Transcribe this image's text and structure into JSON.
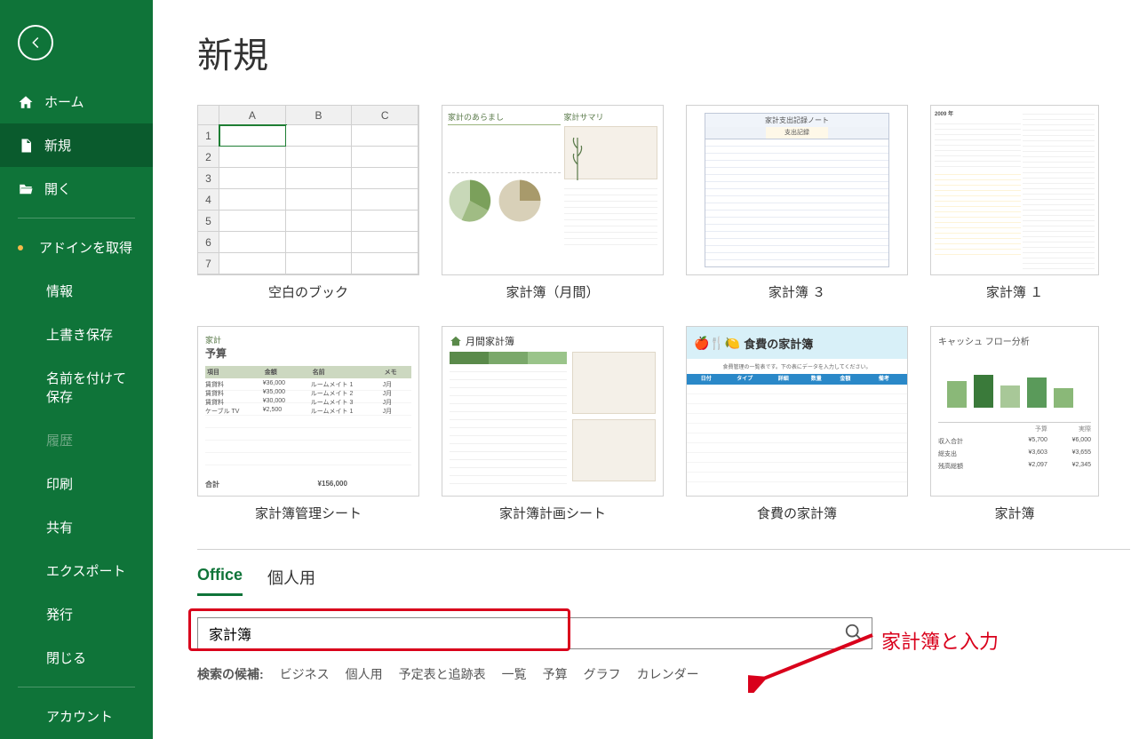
{
  "sidebar": {
    "home": "ホーム",
    "new": "新規",
    "open": "開く",
    "get_addins": "アドインを取得",
    "info": "情報",
    "save": "上書き保存",
    "save_as": "名前を付けて保存",
    "history": "履歴",
    "print": "印刷",
    "share": "共有",
    "export": "エクスポート",
    "publish": "発行",
    "close": "閉じる",
    "account": "アカウント"
  },
  "page_title": "新規",
  "templates_row1": [
    {
      "label": "空白のブック"
    },
    {
      "label": "家計簿（月間）"
    },
    {
      "label": "家計簿 ３"
    },
    {
      "label": "家計簿 １"
    }
  ],
  "templates_row2": [
    {
      "label": "家計簿管理シート"
    },
    {
      "label": "家計簿計画シート"
    },
    {
      "label": "食費の家計簿"
    },
    {
      "label": "家計簿"
    }
  ],
  "tabs": {
    "office": "Office",
    "personal": "個人用"
  },
  "search": {
    "value": "家計簿"
  },
  "annotation_text": "家計簿と入力",
  "suggested": {
    "label": "検索の候補:",
    "items": [
      "ビジネス",
      "個人用",
      "予定表と追跡表",
      "一覧",
      "予算",
      "グラフ",
      "カレンダー"
    ]
  },
  "thumb": {
    "blank_cols": [
      "A",
      "B",
      "C"
    ],
    "blank_rows": [
      "1",
      "2",
      "3",
      "4",
      "5",
      "6",
      "7"
    ],
    "t2_left_title": "家計のあらまし",
    "t2_right_title": "家計サマリ",
    "t3_title": "家計支出記録ノート",
    "t4_year": "2009 年",
    "t5_title": "予算",
    "t5_total": "¥156,000",
    "t6_title": "月間家計簿",
    "t7_title": "食費の家計簿",
    "t8_title": "キャッシュ フロー分析",
    "t8_row1_label": "収入合計",
    "t8_row1_v1": "¥5,700",
    "t8_row1_v2": "¥6,000",
    "t8_row2_label": "総支出",
    "t8_row2_v1": "¥3,603",
    "t8_row2_v2": "¥3,655",
    "t8_row3_label": "残高総額",
    "t8_row3_v1": "¥2,097",
    "t8_row3_v2": "¥2,345"
  }
}
